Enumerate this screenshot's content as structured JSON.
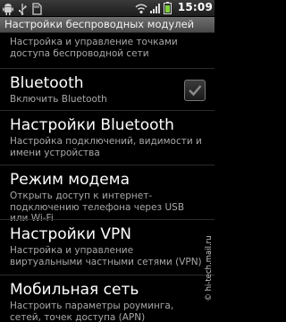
{
  "status_bar": {
    "time": "15:09",
    "left_icons": [
      "android-icon",
      "usb-icon",
      "sd-card-icon"
    ],
    "right_icons": [
      "wifi-icon",
      "signal-icon",
      "battery-icon"
    ]
  },
  "screen_title": "Настройки беспроводных модулей",
  "items": [
    {
      "title": "",
      "summary": "Настройка и управление точками доступа беспроводной сети"
    },
    {
      "title": "Bluetooth",
      "summary": "Включить Bluetooth",
      "checked": true
    },
    {
      "title": "Настройки Bluetooth",
      "summary": "Настройка подключений, видимости и имени устройства"
    },
    {
      "title": "Режим модема",
      "summary": "Открыть доступ к интернет-подключению телефона через USB или Wi-Fi"
    },
    {
      "title": "Настройки VPN",
      "summary": "Настройка и управление виртуальными частными сетями (VPN)"
    },
    {
      "title": "Мобильная сеть",
      "summary": "Настроить параметры роуминга, сетей, точек доступа (APN)"
    }
  ],
  "watermark": "© hi-tech.mail.ru"
}
